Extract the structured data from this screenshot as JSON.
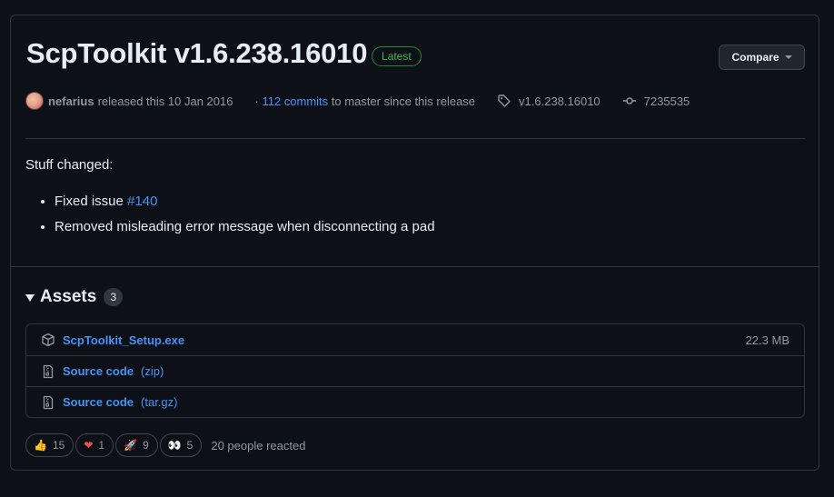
{
  "release": {
    "title": "ScpToolkit v1.6.238.16010",
    "badge": "Latest",
    "compare_label": "Compare",
    "author": "nefarius",
    "released_text": "released this 10 Jan 2016",
    "commits_prefix": "·",
    "commits_link": "112 commits",
    "commits_suffix": "to master since this release",
    "tag": "v1.6.238.16010",
    "commit_sha": "7235535"
  },
  "notes": {
    "heading": "Stuff changed:",
    "item1_text": "Fixed issue ",
    "item1_link": "#140",
    "item2_text": "Removed misleading error message when disconnecting a pad"
  },
  "assets": {
    "title": "Assets",
    "count": "3",
    "rows": [
      {
        "name": "ScpToolkit_Setup.exe",
        "ext": "",
        "size": "22.3 MB",
        "icon": "package-icon"
      },
      {
        "name": "Source code",
        "ext": "(zip)",
        "size": "",
        "icon": "file-zip-icon"
      },
      {
        "name": "Source code",
        "ext": "(tar.gz)",
        "size": "",
        "icon": "file-zip-icon"
      }
    ]
  },
  "reactions": {
    "items": [
      {
        "emoji": "👍",
        "count": "15",
        "icon": "thumbs-up-icon"
      },
      {
        "emoji": "❤",
        "count": "1",
        "icon": "heart-icon"
      },
      {
        "emoji": "🚀",
        "count": "9",
        "icon": "rocket-icon"
      },
      {
        "emoji": "👀",
        "count": "5",
        "icon": "eyes-icon"
      }
    ],
    "summary": "20 people reacted"
  },
  "colors": {
    "background": "#0d1117",
    "border": "#30363d",
    "link": "#4493f8",
    "latest_green": "#3fb950",
    "muted": "#9198a1"
  }
}
